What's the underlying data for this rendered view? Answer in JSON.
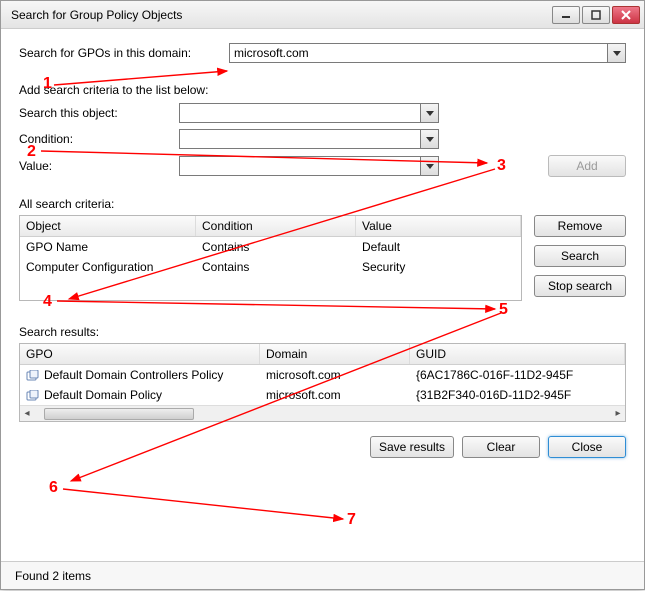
{
  "window": {
    "title": "Search for Group Policy Objects"
  },
  "domainRow": {
    "label": "Search for GPOs in this domain:",
    "value": "microsoft.com"
  },
  "criteriaIntro": "Add search criteria to the list below:",
  "searchThis": {
    "label": "Search this object:",
    "value": ""
  },
  "condition": {
    "label": "Condition:",
    "value": ""
  },
  "valueRow": {
    "label": "Value:",
    "value": ""
  },
  "buttons": {
    "add": "Add",
    "remove": "Remove",
    "search": "Search",
    "stop": "Stop search",
    "save": "Save results",
    "clear": "Clear",
    "close": "Close"
  },
  "criteriaHeader": "All search criteria:",
  "criteriaCols": {
    "object": "Object",
    "condition": "Condition",
    "value": "Value"
  },
  "criteriaRows": [
    {
      "object": "GPO Name",
      "condition": "Contains",
      "value": "Default"
    },
    {
      "object": "Computer Configuration",
      "condition": "Contains",
      "value": "Security"
    }
  ],
  "resultsHeader": "Search results:",
  "resultsCols": {
    "gpo": "GPO",
    "domain": "Domain",
    "guid": "GUID"
  },
  "resultsRows": [
    {
      "gpo": "Default Domain Controllers Policy",
      "domain": "microsoft.com",
      "guid": "{6AC1786C-016F-11D2-945F"
    },
    {
      "gpo": "Default Domain Policy",
      "domain": "microsoft.com",
      "guid": "{31B2F340-016D-11D2-945F"
    }
  ],
  "status": "Found 2 items",
  "annotations": {
    "1": "1",
    "2": "2",
    "3": "3",
    "4": "4",
    "5": "5",
    "6": "6",
    "7": "7"
  }
}
